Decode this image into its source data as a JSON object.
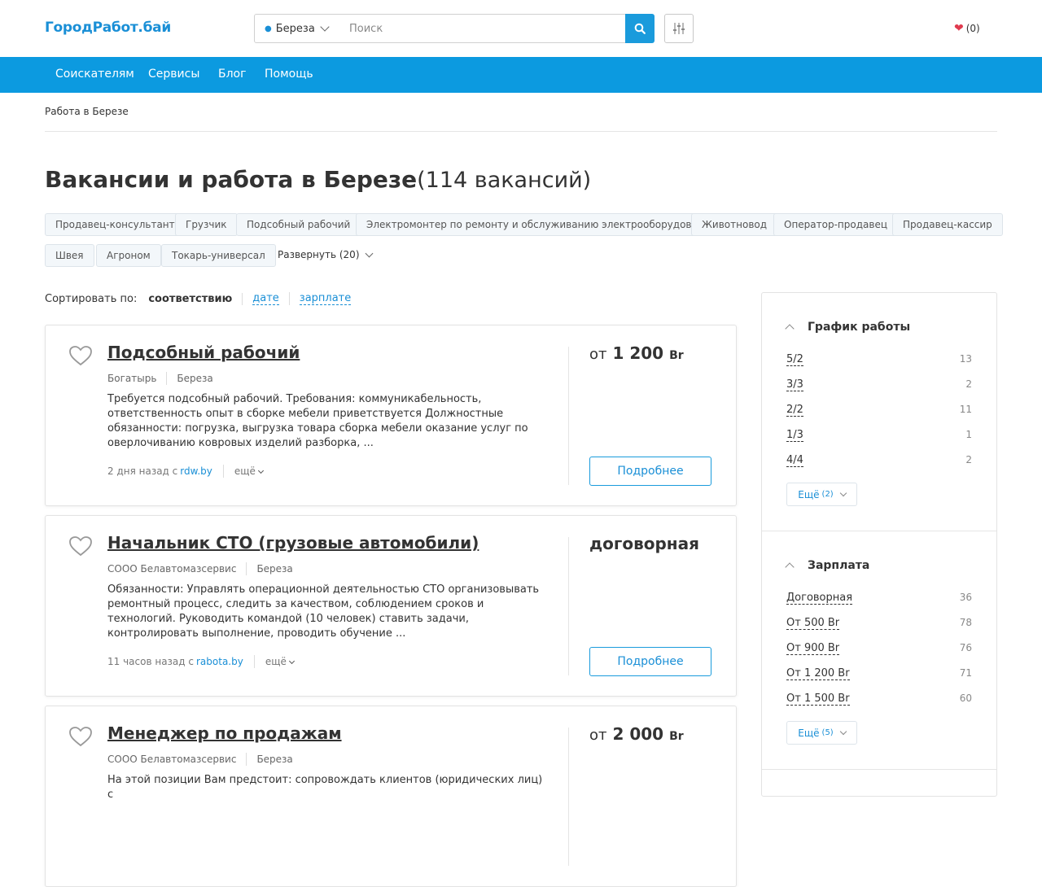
{
  "header": {
    "logo": "ГородРабот.бай",
    "location": "Береза",
    "search_placeholder": "Поиск",
    "favorites": "(0)"
  },
  "nav": {
    "items": [
      "Соискателям",
      "Сервисы",
      "Блог",
      "Помощь"
    ]
  },
  "breadcrumb": "Работа в Березе",
  "page": {
    "title": "Вакансии и работа в Березе",
    "count": "(114 вакансий)"
  },
  "tags": [
    "Продавец-консультант",
    "Грузчик",
    "Подсобный рабочий",
    "Электромонтер по ремонту и обслуживанию электрооборудования",
    "Животновод",
    "Оператор-продавец",
    "Продавец-кассир",
    "Швея",
    "Агроном",
    "Токарь-универсал"
  ],
  "expand_label": "Развернуть (20)",
  "sort": {
    "label": "Сортировать по:",
    "active": "соответствию",
    "options": [
      "дате",
      "зарплате"
    ]
  },
  "jobs": [
    {
      "title": "Подсобный рабочий",
      "company": "Богатырь",
      "city": "Береза",
      "description": "Требуется подсобный рабочий. Требования: коммуникабельность, ответственность опыт в сборке мебели приветствуется Должностные обязанности: погрузка, выгрузка товара сборка мебели оказание услуг по оверлочиванию ковровых изделий разборка, ...",
      "time": "2 дня назад с",
      "source": "rdw.by",
      "more": "ещё",
      "salary_prefix": "от",
      "salary": "1 200",
      "currency": "Br",
      "button": "Подробнее"
    },
    {
      "title": "Начальник СТО (грузовые автомобили)",
      "company": "СООО Белавтомазсервис",
      "city": "Береза",
      "description": "Обязанности: Управлять операционной деятельностью СТО организовывать ремонтный процесс, следить за качеством, соблюдением сроков и технологий. Руководить командой (10 человек) ставить задачи, контролировать выполнение, проводить обучение ...",
      "time": "11 часов назад с",
      "source": "rabota.by",
      "more": "ещё",
      "salary_prefix": "",
      "salary": "договорная",
      "currency": "",
      "button": "Подробнее"
    },
    {
      "title": "Менеджер по продажам",
      "company": "СООО Белавтомазсервис",
      "city": "Береза",
      "description": "На этой позиции Вам предстоит: сопровождать клиентов (юридических лиц) с",
      "time": "",
      "source": "",
      "more": "",
      "salary_prefix": "от",
      "salary": "2 000",
      "currency": "Br",
      "button": ""
    }
  ],
  "sidebar": {
    "schedule": {
      "title": "График работы",
      "items": [
        {
          "label": "5/2",
          "count": "13"
        },
        {
          "label": "3/3",
          "count": "2"
        },
        {
          "label": "2/2",
          "count": "11"
        },
        {
          "label": "1/3",
          "count": "1"
        },
        {
          "label": "4/4",
          "count": "2"
        }
      ],
      "more": "Ещё",
      "more_count": "(2)"
    },
    "salary": {
      "title": "Зарплата",
      "items": [
        {
          "label": "Договорная",
          "count": "36"
        },
        {
          "label": "От 500 Br",
          "count": "78"
        },
        {
          "label": "От 900 Br",
          "count": "76"
        },
        {
          "label": "От 1 200 Br",
          "count": "71"
        },
        {
          "label": "От 1 500 Br",
          "count": "60"
        }
      ],
      "more": "Ещё",
      "more_count": "(5)"
    }
  },
  "colors": {
    "primary": "#0c9ae0",
    "link": "#1a8fd6",
    "heart": "#e03b4f"
  }
}
